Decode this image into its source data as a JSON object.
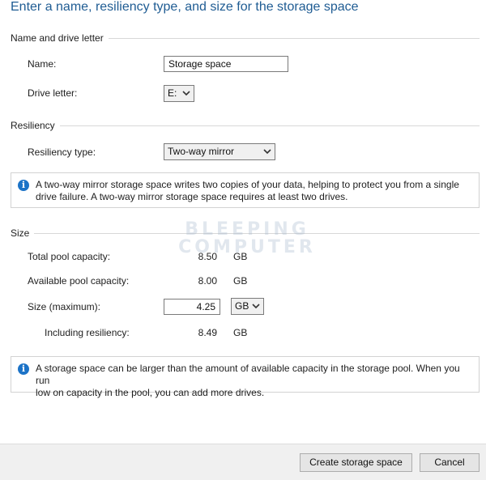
{
  "header": {
    "title": "Enter a name, resiliency type, and size for the storage space"
  },
  "name_section": {
    "heading": "Name and drive letter",
    "name_label": "Name:",
    "name_value": "Storage space",
    "drive_label": "Drive letter:",
    "drive_value": "E:"
  },
  "resiliency_section": {
    "heading": "Resiliency",
    "type_label": "Resiliency type:",
    "type_value": "Two-way mirror",
    "info_line1": "A two-way mirror storage space writes two copies of your data, helping to protect you from a single",
    "info_line2": "drive failure. A two-way mirror storage space requires at least two drives."
  },
  "size_section": {
    "heading": "Size",
    "total_label": "Total pool capacity:",
    "total_value": "8.50",
    "total_unit": "GB",
    "available_label": "Available pool capacity:",
    "available_value": "8.00",
    "available_unit": "GB",
    "size_label": "Size (maximum):",
    "size_value": "4.25",
    "size_unit": "GB",
    "including_label": "Including resiliency:",
    "including_value": "8.49",
    "including_unit": "GB",
    "info_line1": "A storage space can be larger than the amount of available capacity in the storage pool. When you run",
    "info_line2": "low on capacity in the pool, you can add more drives."
  },
  "watermark": {
    "line1": "BLEEPING",
    "line2": "COMPUTER"
  },
  "footer": {
    "create_label": "Create storage space",
    "cancel_label": "Cancel"
  },
  "icons": {
    "info": "info-icon",
    "dropdown": "chevron-down-icon"
  },
  "colors": {
    "title": "#1f5c93",
    "info_icon": "#1c73c7"
  }
}
